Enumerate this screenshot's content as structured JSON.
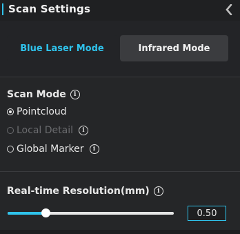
{
  "header": {
    "title": "Scan Settings",
    "collapse_icon": "chevron-left-icon"
  },
  "modes": {
    "blue_laser": "Blue Laser Mode",
    "infrared": "Infrared Mode",
    "selected": "Infrared Mode"
  },
  "scan_mode": {
    "title": "Scan Mode",
    "options": [
      {
        "label": "Pointcloud",
        "checked": true,
        "disabled": false
      },
      {
        "label": "Local Detail",
        "checked": false,
        "disabled": true
      },
      {
        "label": "Global Marker",
        "checked": false,
        "disabled": false
      }
    ]
  },
  "resolution": {
    "title": "Real-time Resolution(mm)",
    "value": "0.50",
    "slider_fraction": 0.23
  },
  "colors": {
    "accent": "#2fc3ec",
    "background": "#252628",
    "header_bg": "#1f2022",
    "selected_button_bg": "#3b3c3f"
  }
}
